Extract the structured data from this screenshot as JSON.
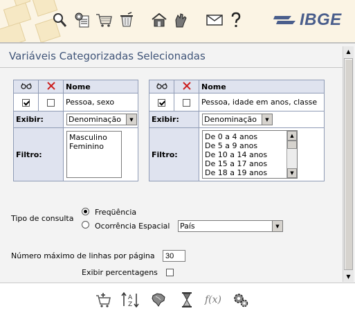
{
  "brand": {
    "logo_text": "IBGE"
  },
  "toolbar_icons": [
    "magnifier-icon",
    "settings-doc-icon",
    "cart-icon",
    "trash-icon",
    "house-icon",
    "hand-icon",
    "mail-icon",
    "help-icon"
  ],
  "page": {
    "title": "Variáveis Categorizadas Selecionadas"
  },
  "tables": [
    {
      "header": {
        "name_label": "Nome"
      },
      "row": {
        "checked": true,
        "removed": false,
        "name": "Pessoa, sexo"
      },
      "exibir": {
        "label": "Exibir:",
        "selected": "Denominação"
      },
      "filtro": {
        "label": "Filtro:",
        "items": [
          "Masculino",
          "Feminino"
        ]
      }
    },
    {
      "header": {
        "name_label": "Nome"
      },
      "row": {
        "checked": true,
        "removed": false,
        "name": "Pessoa, idade em anos, classe"
      },
      "exibir": {
        "label": "Exibir:",
        "selected": "Denominação"
      },
      "filtro": {
        "label": "Filtro:",
        "items": [
          "De 0 a 4 anos",
          "De 5 a 9 anos",
          "De 10 a 14 anos",
          "De 15 a 17 anos",
          "De 18 a 19 anos"
        ]
      }
    }
  ],
  "query": {
    "label": "Tipo de consulta",
    "option_frequency": "Freqüência",
    "option_spatial": "Ocorrência Espacial",
    "selected": "frequency",
    "spatial_select": "País"
  },
  "max_rows": {
    "label": "Número máximo de linhas por página",
    "value": "30"
  },
  "percent": {
    "label": "Exibir percentagens",
    "checked": false
  },
  "bottom_toolbar": {
    "fx_label": "f(x)"
  }
}
